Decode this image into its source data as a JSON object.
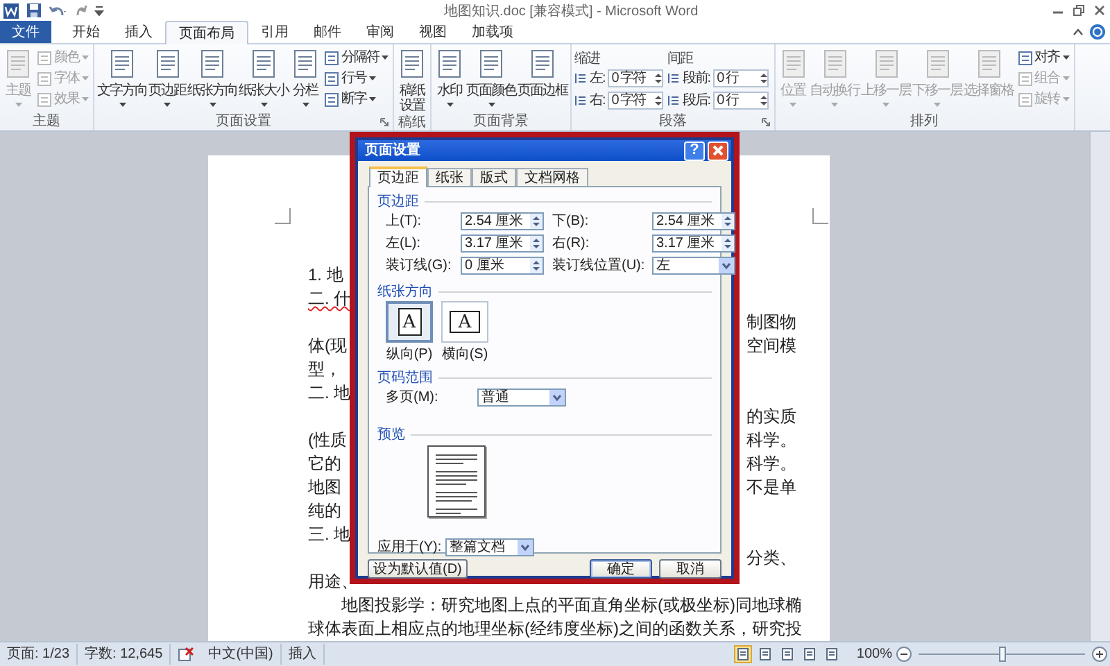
{
  "window": {
    "title": "地图知识.doc [兼容模式] - Microsoft Word"
  },
  "tabs": [
    {
      "label": "文件",
      "kind": "file",
      "selected": false
    },
    {
      "label": "开始",
      "kind": "tab",
      "selected": false
    },
    {
      "label": "插入",
      "kind": "tab",
      "selected": false
    },
    {
      "label": "页面布局",
      "kind": "tab",
      "selected": true
    },
    {
      "label": "引用",
      "kind": "tab",
      "selected": false
    },
    {
      "label": "邮件",
      "kind": "tab",
      "selected": false
    },
    {
      "label": "审阅",
      "kind": "tab",
      "selected": false
    },
    {
      "label": "视图",
      "kind": "tab",
      "selected": false
    },
    {
      "label": "加载项",
      "kind": "tab",
      "selected": false
    }
  ],
  "ribbon": {
    "groups": [
      {
        "label": "主题",
        "launcher": false,
        "items": [
          {
            "kind": "large",
            "label": "主题",
            "dropdown": true,
            "disabled": true
          },
          {
            "kind": "stack",
            "items": [
              {
                "label": "颜色",
                "dropdown": true,
                "disabled": true
              },
              {
                "label": "字体",
                "dropdown": true,
                "disabled": true
              },
              {
                "label": "效果",
                "dropdown": true,
                "disabled": true
              }
            ]
          }
        ]
      },
      {
        "label": "页面设置",
        "launcher": true,
        "items": [
          {
            "kind": "large",
            "label": "文字方向",
            "dropdown": true,
            "disabled": false
          },
          {
            "kind": "large",
            "label": "页边距",
            "dropdown": true,
            "disabled": false
          },
          {
            "kind": "large",
            "label": "纸张方向",
            "dropdown": true,
            "disabled": false
          },
          {
            "kind": "large",
            "label": "纸张大小",
            "dropdown": true,
            "disabled": false
          },
          {
            "kind": "large",
            "label": "分栏",
            "dropdown": true,
            "disabled": false
          },
          {
            "kind": "stack",
            "items": [
              {
                "label": "分隔符",
                "dropdown": true,
                "disabled": false
              },
              {
                "label": "行号",
                "dropdown": true,
                "disabled": false
              },
              {
                "label": "断字",
                "dropdown": true,
                "disabled": false
              }
            ]
          }
        ]
      },
      {
        "label": "稿纸",
        "launcher": false,
        "items": [
          {
            "kind": "large",
            "label": "稿纸设置",
            "dropdown": false,
            "disabled": false
          }
        ]
      },
      {
        "label": "页面背景",
        "launcher": false,
        "items": [
          {
            "kind": "large",
            "label": "水印",
            "dropdown": true,
            "disabled": false
          },
          {
            "kind": "large",
            "label": "页面颜色",
            "dropdown": true,
            "disabled": false
          },
          {
            "kind": "large",
            "label": "页面边框",
            "dropdown": false,
            "disabled": false
          }
        ]
      },
      {
        "label": "段落",
        "launcher": true,
        "items": [
          {
            "kind": "spin_stack",
            "heading": "缩进",
            "items": [
              {
                "label": "左:",
                "value": "0 字符"
              },
              {
                "label": "右:",
                "value": "0 字符"
              }
            ]
          },
          {
            "kind": "spin_stack",
            "heading": "间距",
            "items": [
              {
                "label": "段前:",
                "value": "0 行"
              },
              {
                "label": "段后:",
                "value": "0 行"
              }
            ]
          }
        ]
      },
      {
        "label": "排列",
        "launcher": false,
        "items": [
          {
            "kind": "large",
            "label": "位置",
            "dropdown": true,
            "disabled": true
          },
          {
            "kind": "large",
            "label": "自动换行",
            "dropdown": true,
            "disabled": true
          },
          {
            "kind": "large",
            "label": "上移一层",
            "dropdown": true,
            "disabled": true
          },
          {
            "kind": "large",
            "label": "下移一层",
            "dropdown": true,
            "disabled": true
          },
          {
            "kind": "large",
            "label": "选择窗格",
            "dropdown": false,
            "disabled": true
          },
          {
            "kind": "stack",
            "items": [
              {
                "label": "对齐",
                "dropdown": true,
                "disabled": false
              },
              {
                "label": "组合",
                "dropdown": true,
                "disabled": true
              },
              {
                "label": "旋转",
                "dropdown": true,
                "disabled": true
              }
            ]
          }
        ]
      }
    ]
  },
  "document": {
    "lines": [
      {
        "kind": "split",
        "indent": false,
        "spell_mark": false,
        "left": "1. 地"
      },
      {
        "kind": "split",
        "indent": false,
        "spell_mark": true,
        "left": "二. 什"
      },
      {
        "kind": "split",
        "right": "制图物"
      },
      {
        "kind": "split",
        "indent": false,
        "spell_mark": false,
        "left": "体(现",
        "right": "空间模"
      },
      {
        "kind": "split",
        "indent": false,
        "spell_mark": false,
        "left": "型，"
      },
      {
        "kind": "split",
        "indent": false,
        "spell_mark": false,
        "left": "二. 地"
      },
      {
        "kind": "split",
        "right": "的实质"
      },
      {
        "kind": "split",
        "indent": false,
        "spell_mark": false,
        "left": "(性质",
        "right": "科学。"
      },
      {
        "kind": "split",
        "indent": false,
        "spell_mark": false,
        "left": "它的",
        "right": "科学。"
      },
      {
        "kind": "split",
        "indent": false,
        "spell_mark": false,
        "left": "地图",
        "right": "不是单"
      },
      {
        "kind": "split",
        "indent": false,
        "spell_mark": false,
        "left": "纯的"
      },
      {
        "kind": "split",
        "indent": false,
        "spell_mark": false,
        "left": "三. 地"
      },
      {
        "kind": "split",
        "right": "分类、"
      },
      {
        "kind": "split",
        "indent": false,
        "spell_mark": false,
        "left": "用途、"
      },
      {
        "kind": "full_indented",
        "spell_mark": false,
        "text": "地图投影学：研究地图上点的平面直角坐标(或极坐标)同地球椭"
      },
      {
        "kind": "full",
        "indent": false,
        "spell_mark": false,
        "text": "球体表面上相应点的地理坐标(经纬度坐标)之间的函数关系，研究投"
      }
    ]
  },
  "dialog": {
    "title": "页面设置",
    "help_button": "?",
    "tabs": [
      {
        "label": "页边距",
        "selected": true
      },
      {
        "label": "纸张",
        "selected": false
      },
      {
        "label": "版式",
        "selected": false
      },
      {
        "label": "文档网格",
        "selected": false
      }
    ],
    "margins_heading": "页边距",
    "margins": [
      {
        "label": "上(T):",
        "value": "2.54 厘米",
        "kind": "spin"
      },
      {
        "label": "下(B):",
        "value": "2.54 厘米",
        "kind": "spin"
      },
      {
        "label": "左(L):",
        "value": "3.17 厘米",
        "kind": "spin"
      },
      {
        "label": "右(R):",
        "value": "3.17 厘米",
        "kind": "spin"
      },
      {
        "label": "装订线(G):",
        "value": "0 厘米",
        "kind": "spin"
      },
      {
        "label": "装订线位置(U):",
        "value": "左",
        "kind": "dropdown"
      }
    ],
    "orientation_heading": "纸张方向",
    "orientations": [
      {
        "label": "纵向(P)",
        "glyph": "A",
        "selected": true
      },
      {
        "label": "横向(S)",
        "glyph": "A",
        "selected": false
      }
    ],
    "pages_heading": "页码范围",
    "multiple_pages": {
      "label": "多页(M):",
      "value": "普通"
    },
    "preview_heading": "预览",
    "apply_to": {
      "label": "应用于(Y):",
      "value": "整篇文档"
    },
    "buttons": [
      {
        "label": "设为默认值(D)",
        "kind": "left"
      },
      {
        "label": "确定",
        "kind": "primary"
      },
      {
        "label": "取消",
        "kind": "normal"
      }
    ]
  },
  "status_bar": {
    "items": [
      {
        "kind": "text",
        "label": "页面: 1/23"
      },
      {
        "kind": "text",
        "label": "字数: 12,645"
      },
      {
        "kind": "icon"
      },
      {
        "kind": "text",
        "label": "中文(中国)"
      },
      {
        "kind": "text",
        "label": "插入"
      }
    ],
    "views": [
      {
        "selected": true
      },
      {
        "selected": false
      },
      {
        "selected": false
      },
      {
        "selected": false
      },
      {
        "selected": false
      }
    ],
    "zoom": {
      "label": "100%",
      "level": 0.5
    }
  }
}
